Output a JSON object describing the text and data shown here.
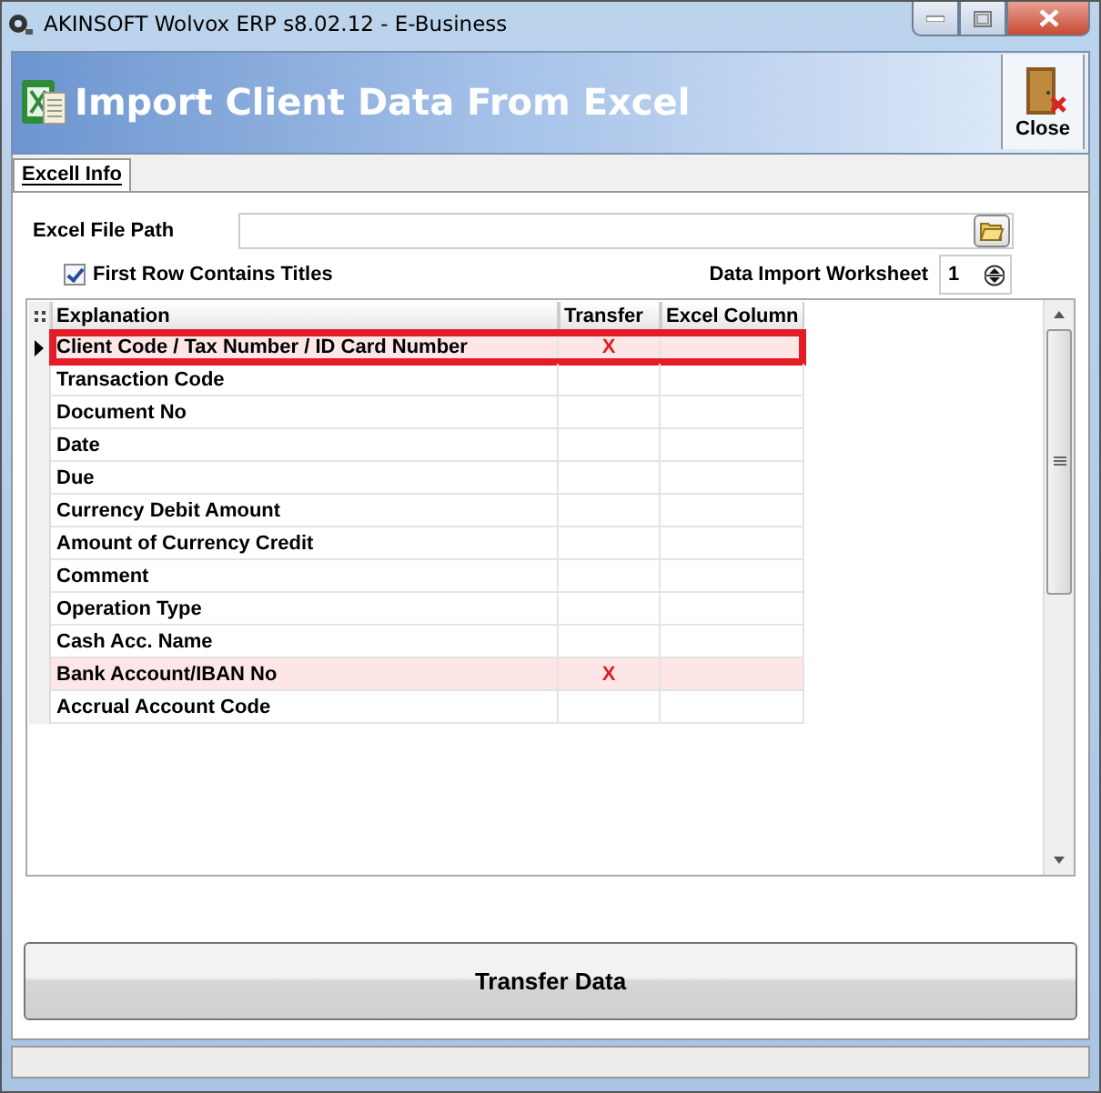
{
  "window": {
    "title": "AKINSOFT Wolvox ERP s8.02.12 - E-Business"
  },
  "header": {
    "title": "Import Client Data From Excel",
    "close_label": "Close"
  },
  "tabs": [
    {
      "label": "Excell Info",
      "selected": true
    }
  ],
  "form": {
    "file_path_label": "Excel File Path",
    "first_row_label": "First Row Contains Titles",
    "first_row_checked": true,
    "worksheet_label": "Data Import Worksheet",
    "worksheet_value": "1"
  },
  "table": {
    "columns": [
      "Explanation",
      "Transfer",
      "Excel Column"
    ],
    "rows": [
      {
        "explanation": "Client Code / Tax Number / ID Card Number",
        "transfer": "X",
        "highlighted": true,
        "selected": true
      },
      {
        "explanation": "Transaction Code",
        "highlighted": false,
        "selected": false
      },
      {
        "explanation": "Document No",
        "highlighted": false,
        "selected": false
      },
      {
        "explanation": "Date",
        "highlighted": false,
        "selected": false
      },
      {
        "explanation": "Due",
        "highlighted": false,
        "selected": false
      },
      {
        "explanation": "Currency Debit Amount",
        "highlighted": false,
        "selected": false
      },
      {
        "explanation": "Amount of Currency Credit",
        "highlighted": false,
        "selected": false
      },
      {
        "explanation": "Comment",
        "highlighted": false,
        "selected": false
      },
      {
        "explanation": "Operation Type",
        "highlighted": false,
        "selected": false
      },
      {
        "explanation": "Cash Acc. Name",
        "highlighted": false,
        "selected": false
      },
      {
        "explanation": "Bank Account/IBAN No",
        "transfer": "X",
        "highlighted": true,
        "selected": false
      },
      {
        "explanation": "Accrual Account Code",
        "highlighted": false,
        "selected": false
      }
    ]
  },
  "buttons": [
    {
      "label": "Transfer Data"
    }
  ]
}
